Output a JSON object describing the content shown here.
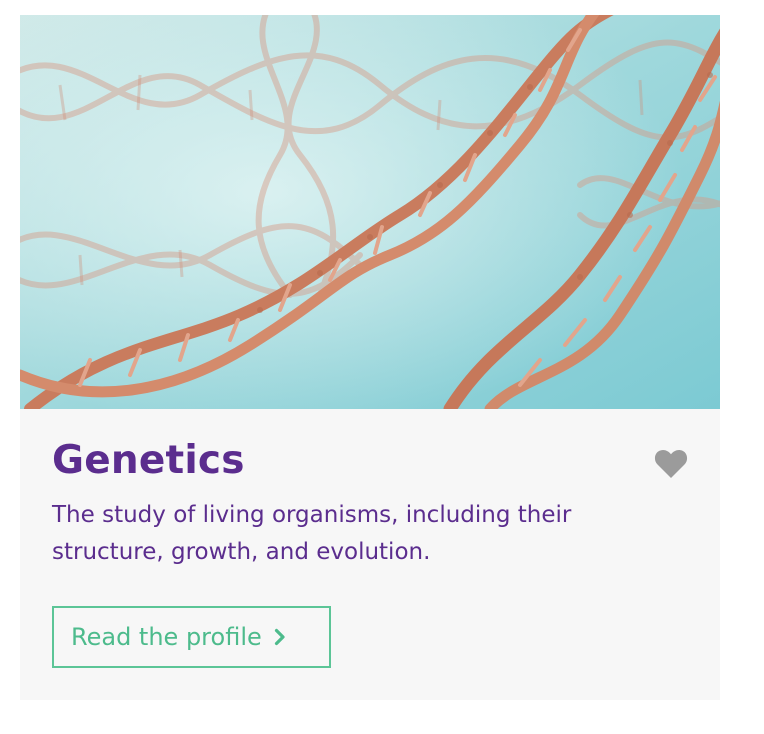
{
  "card": {
    "image_alt": "DNA double helix strands",
    "title": "Genetics",
    "description": "The study of living organisms, including their structure, growth, and evolution.",
    "cta_label": "Read the profile",
    "favorite_icon": "heart-icon",
    "cta_icon": "chevron-right-icon"
  },
  "colors": {
    "title": "#5b2d8e",
    "cta": "#4dbb8c",
    "heart": "#9b9b9b",
    "card_bg": "#f7f7f7"
  }
}
